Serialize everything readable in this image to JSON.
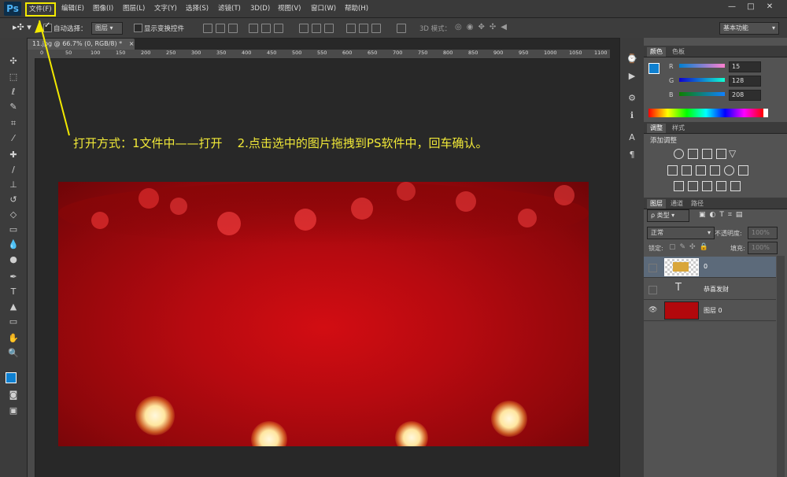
{
  "app": {
    "logo": "Ps"
  },
  "menu": [
    "文件(F)",
    "编辑(E)",
    "图像(I)",
    "图层(L)",
    "文字(Y)",
    "选择(S)",
    "滤镜(T)",
    "3D(D)",
    "视图(V)",
    "窗口(W)",
    "帮助(H)"
  ],
  "window_controls": {
    "minimize": "—",
    "restore": "□",
    "close": "✕"
  },
  "options": {
    "auto_select_label": "自动选择：",
    "auto_select_value": "图层",
    "show_transform_label": "显示变换控件",
    "mode_3d_label": "3D 模式：",
    "workspace": "基本功能"
  },
  "document": {
    "tab_title": "11.jpg @ 66.7% (0, RGB/8) *",
    "close": "×"
  },
  "ruler_ticks": [
    "0",
    "50",
    "100",
    "150",
    "200",
    "250",
    "300",
    "350",
    "400",
    "450",
    "500",
    "550",
    "600",
    "650",
    "700",
    "750",
    "800",
    "850",
    "900",
    "950",
    "1000",
    "1050",
    "1100"
  ],
  "annotation": "打开方式：1文件中——打开    2.点击选中的图片拖拽到PS软件中，回车确认。",
  "color_panel": {
    "tabs": [
      "颜色",
      "色板"
    ],
    "channels": [
      {
        "name": "R",
        "value": "15"
      },
      {
        "name": "G",
        "value": "128"
      },
      {
        "name": "B",
        "value": "208"
      }
    ],
    "fg_color": "#0f80d0"
  },
  "adjust_panel": {
    "tabs": [
      "调整",
      "样式"
    ],
    "title": "添加调整"
  },
  "layers_panel": {
    "tabs": [
      "图层",
      "通道",
      "路径"
    ],
    "filter_kind": "ρ 类型",
    "blend_mode": "正常",
    "opacity_label": "不透明度:",
    "opacity_value": "100%",
    "lock_label": "锁定:",
    "fill_label": "填充:",
    "fill_value": "100%",
    "layers": [
      {
        "name": "0",
        "type": "smart",
        "selected": true,
        "visible": false
      },
      {
        "name": "恭喜发财",
        "type": "text",
        "selected": false,
        "visible": false
      },
      {
        "name": "图层 0",
        "type": "image",
        "selected": false,
        "visible": true
      }
    ]
  },
  "colors": {
    "highlight": "#f2e900",
    "selected_layer": "#5c6a7a"
  }
}
